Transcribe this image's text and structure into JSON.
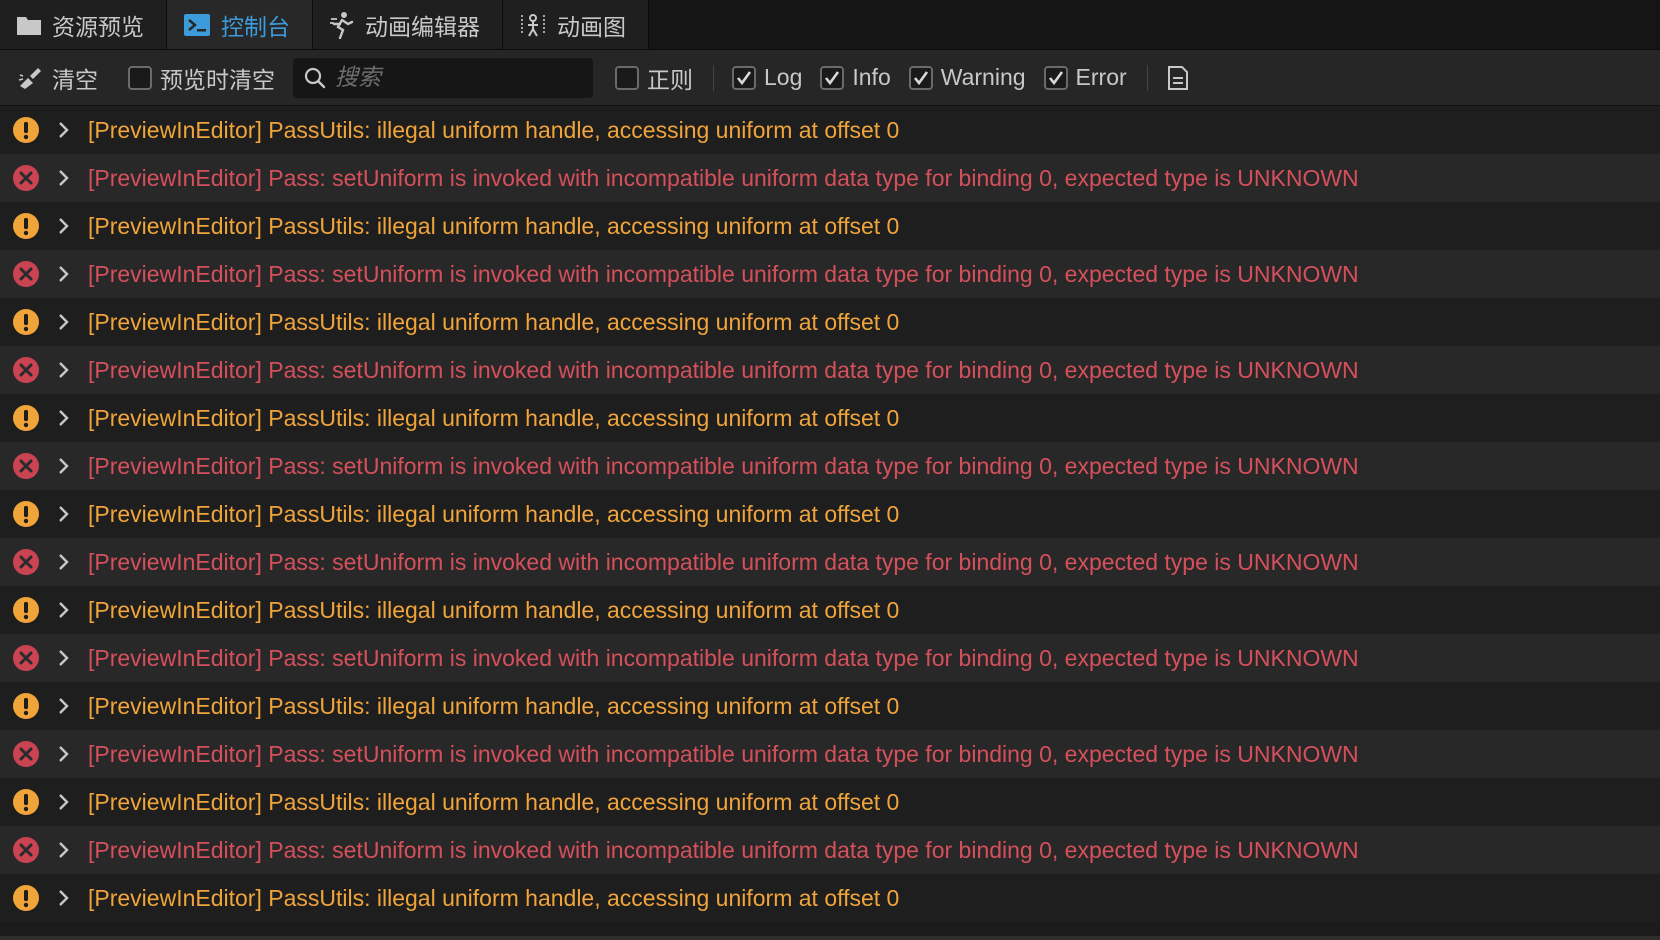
{
  "tabs": [
    {
      "label": "资源预览",
      "icon": "folder-icon",
      "active": false
    },
    {
      "label": "控制台",
      "icon": "terminal-icon",
      "active": true
    },
    {
      "label": "动画编辑器",
      "icon": "running-figure-icon",
      "active": false
    },
    {
      "label": "动画图",
      "icon": "animation-graph-icon",
      "active": false
    }
  ],
  "toolbar": {
    "clear_label": "清空",
    "clear_on_preview_label": "预览时清空",
    "search_placeholder": "搜索",
    "regex_label": "正则",
    "log_label": "Log",
    "info_label": "Info",
    "warning_label": "Warning",
    "error_label": "Error"
  },
  "logs": [
    {
      "level": "warning",
      "text": "[PreviewInEditor] PassUtils: illegal uniform handle, accessing uniform at offset 0"
    },
    {
      "level": "error",
      "text": "[PreviewInEditor] Pass: setUniform is invoked with incompatible uniform data type for binding 0, expected type is UNKNOWN"
    },
    {
      "level": "warning",
      "text": "[PreviewInEditor] PassUtils: illegal uniform handle, accessing uniform at offset 0"
    },
    {
      "level": "error",
      "text": "[PreviewInEditor] Pass: setUniform is invoked with incompatible uniform data type for binding 0, expected type is UNKNOWN"
    },
    {
      "level": "warning",
      "text": "[PreviewInEditor] PassUtils: illegal uniform handle, accessing uniform at offset 0"
    },
    {
      "level": "error",
      "text": "[PreviewInEditor] Pass: setUniform is invoked with incompatible uniform data type for binding 0, expected type is UNKNOWN"
    },
    {
      "level": "warning",
      "text": "[PreviewInEditor] PassUtils: illegal uniform handle, accessing uniform at offset 0"
    },
    {
      "level": "error",
      "text": "[PreviewInEditor] Pass: setUniform is invoked with incompatible uniform data type for binding 0, expected type is UNKNOWN"
    },
    {
      "level": "warning",
      "text": "[PreviewInEditor] PassUtils: illegal uniform handle, accessing uniform at offset 0"
    },
    {
      "level": "error",
      "text": "[PreviewInEditor] Pass: setUniform is invoked with incompatible uniform data type for binding 0, expected type is UNKNOWN"
    },
    {
      "level": "warning",
      "text": "[PreviewInEditor] PassUtils: illegal uniform handle, accessing uniform at offset 0"
    },
    {
      "level": "error",
      "text": "[PreviewInEditor] Pass: setUniform is invoked with incompatible uniform data type for binding 0, expected type is UNKNOWN"
    },
    {
      "level": "warning",
      "text": "[PreviewInEditor] PassUtils: illegal uniform handle, accessing uniform at offset 0"
    },
    {
      "level": "error",
      "text": "[PreviewInEditor] Pass: setUniform is invoked with incompatible uniform data type for binding 0, expected type is UNKNOWN"
    },
    {
      "level": "warning",
      "text": "[PreviewInEditor] PassUtils: illegal uniform handle, accessing uniform at offset 0"
    },
    {
      "level": "error",
      "text": "[PreviewInEditor] Pass: setUniform is invoked with incompatible uniform data type for binding 0, expected type is UNKNOWN"
    },
    {
      "level": "warning",
      "text": "[PreviewInEditor] PassUtils: illegal uniform handle, accessing uniform at offset 0"
    }
  ],
  "colors": {
    "accent": "#3d9bdc",
    "warning": "#f0a43a",
    "error": "#d6505c",
    "error_icon": "#c94352"
  }
}
